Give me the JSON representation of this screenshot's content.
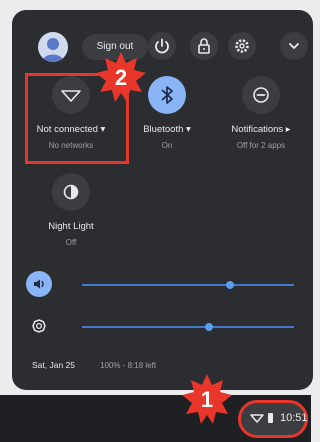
{
  "header": {
    "signout_label": "Sign out"
  },
  "tiles": {
    "network": {
      "label": "Not connected ▾",
      "sub": "No networks"
    },
    "bluetooth": {
      "label": "Bluetooth ▾",
      "sub": "On"
    },
    "notifications": {
      "label": "Notifications ▸",
      "sub": "Off for 2 apps"
    },
    "night_light": {
      "label": "Night Light",
      "sub": "Off"
    }
  },
  "sliders": {
    "volume_level": 0.7,
    "brightness_level": 0.6
  },
  "footer": {
    "date": "Sat, Jan 25",
    "battery": "100% - 8:18 left"
  },
  "tray": {
    "time": "10:51"
  },
  "annotations": {
    "badge_1": "1",
    "badge_2": "2"
  },
  "colors": {
    "accent": "#8ab4f8",
    "highlight": "#e8362b",
    "panel_bg": "#2c2d30"
  }
}
